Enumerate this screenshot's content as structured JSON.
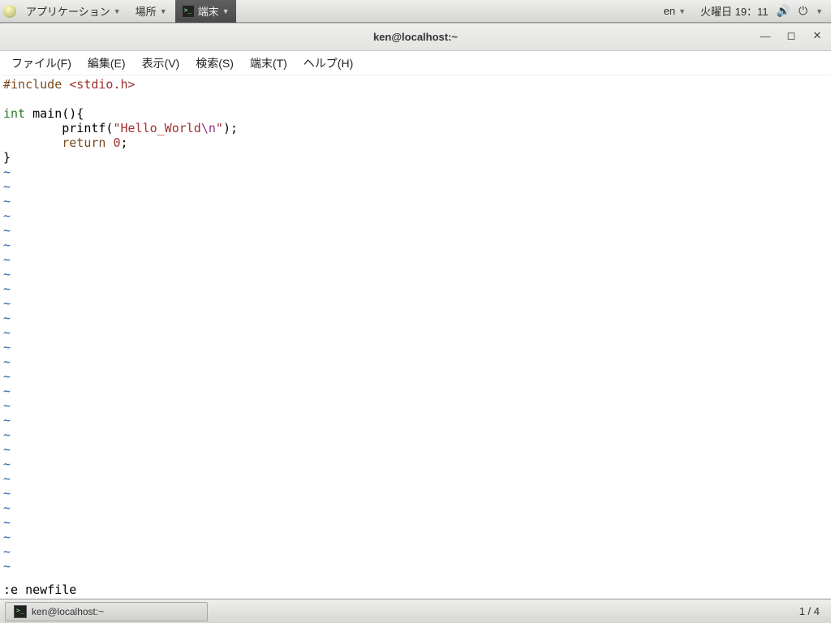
{
  "panel": {
    "apps": "アプリケーション",
    "places": "場所",
    "active_app": "端末",
    "lang": "en",
    "clock": "火曜日 19：11"
  },
  "window": {
    "title": "ken@localhost:~",
    "menus": {
      "file": "ファイル(F)",
      "edit": "編集(E)",
      "view": "表示(V)",
      "search": "検索(S)",
      "terminal": "端末(T)",
      "help": "ヘルプ(H)"
    }
  },
  "code": {
    "l1_a": "#include",
    "l1_b": "<stdio.h>",
    "l3_a": "int",
    "l3_b": " main(){",
    "l4_a": "        printf(",
    "l4_b": "\"Hello_World",
    "l4_c": "\\n",
    "l4_d": "\"",
    "l4_e": ");",
    "l5_a": "        ",
    "l5_b": "return",
    "l5_c": " ",
    "l5_d": "0",
    "l5_e": ";",
    "l6": "}",
    "tilde": "~"
  },
  "cmdline": ":e newfile",
  "taskbar": {
    "task1": "ken@localhost:~"
  },
  "status": {
    "page": "1 / 4"
  }
}
